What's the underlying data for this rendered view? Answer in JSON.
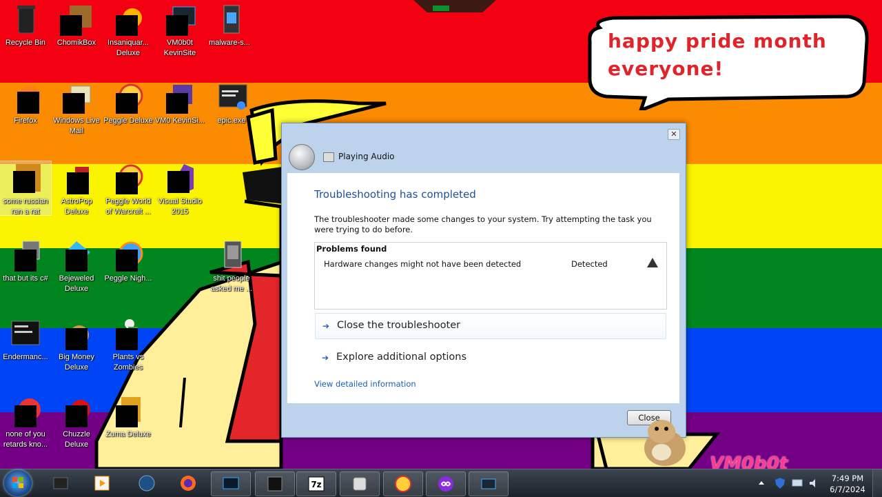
{
  "desktop": {
    "bubble_text": "happy pride month everyone!",
    "corner_logo": "VM0b0t",
    "icons": [
      {
        "label": "Recycle Bin"
      },
      {
        "label": "ChomikBox"
      },
      {
        "label": "Insaniquar... Deluxe"
      },
      {
        "label": "VM0b0t KevinSite"
      },
      {
        "label": "malware-s..."
      },
      {
        "label": "Firefox"
      },
      {
        "label": "Windows Live Mail"
      },
      {
        "label": "Peggle Deluxe"
      },
      {
        "label": "VM0 KevinSi..."
      },
      {
        "label": "epic.exe"
      },
      {
        "label": "some russian ran a rat"
      },
      {
        "label": "AstroPop Deluxe"
      },
      {
        "label": "Peggle World of Warcraft ..."
      },
      {
        "label": "Visual Studio 2015"
      },
      {
        "label": "that but its c#"
      },
      {
        "label": "Bejeweled Deluxe"
      },
      {
        "label": "Peggle Nigh..."
      },
      {
        "label": "shit people asked me ..."
      },
      {
        "label": "Endermanc..."
      },
      {
        "label": "Big Money Deluxe"
      },
      {
        "label": "Plants vs Zombies"
      },
      {
        "label": "none of you retards kno..."
      },
      {
        "label": "Chuzzle Deluxe"
      },
      {
        "label": "Zuma Deluxe"
      }
    ]
  },
  "dialog": {
    "header_title": "Playing Audio",
    "close_x": "✕",
    "heading": "Troubleshooting has completed",
    "description": "The troubleshooter made some changes to your system. Try attempting the task you were trying to do before.",
    "problems_header": "Problems found",
    "problem_name": "Hardware changes might not have been detected",
    "problem_status": "Detected",
    "commands": {
      "close": "Close the troubleshooter",
      "explore": "Explore additional options"
    },
    "arrow_glyph": "➔",
    "detail_link": "View detailed information",
    "close_button": "Close"
  },
  "taskbar": {
    "clock_time": "7:49 PM",
    "clock_date": "6/7/2024",
    "sevenzip_label": "7z"
  }
}
